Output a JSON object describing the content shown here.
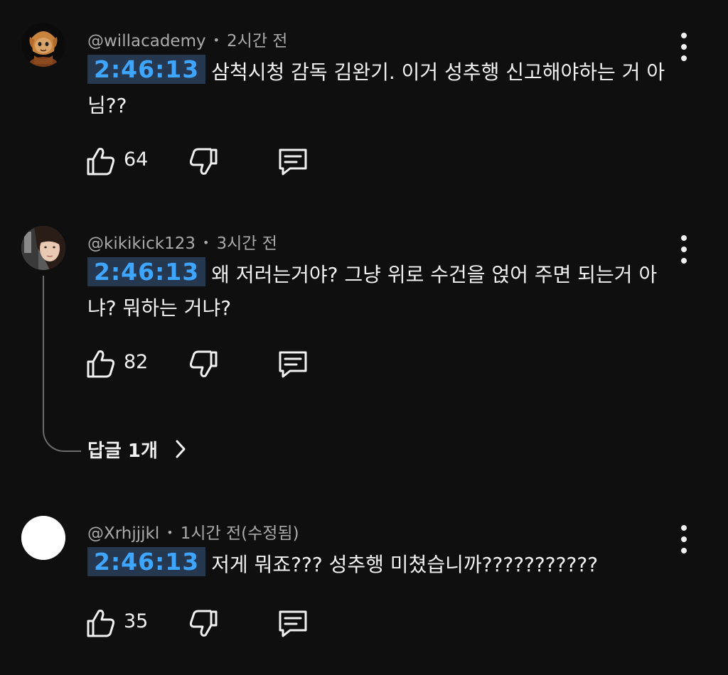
{
  "comments": [
    {
      "username": "@willacademy",
      "time": "2시간 전",
      "timestamp": "2:46:13",
      "text": "삼척시청 감독 김완기. 이거 성추행 신고해야하는 거 아님??",
      "likes": "64",
      "avatar": "orange-character-avatar"
    },
    {
      "username": "@kikikick123",
      "time": "3시간 전",
      "timestamp": "2:46:13",
      "text": "왜 저러는거야? 그냥 위로 수건을 얹어 주면 되는거 아냐? 뭐하는 거냐?",
      "likes": "82",
      "avatar": "person-photo-avatar",
      "replies_label": "답글 1개"
    },
    {
      "username": "@Xrhjjjkl",
      "time": "1시간 전(수정됨)",
      "timestamp": "2:46:13",
      "text": "저게 뭐죠??? 성추행 미쳤습니까???????????",
      "likes": "35",
      "avatar": "blank-white-avatar"
    }
  ],
  "separator": "•",
  "icons": {
    "like": "thumbs-up-icon",
    "dislike": "thumbs-down-icon",
    "reply": "comment-icon",
    "more": "more-vertical-icon",
    "chevron": "chevron-right-icon"
  },
  "colors": {
    "background": "#0f0f0f",
    "timestamp_text": "#3ea6ff",
    "timestamp_bg": "#263850",
    "meta_text": "#aaaaaa",
    "primary_text": "#f1f1f1"
  }
}
